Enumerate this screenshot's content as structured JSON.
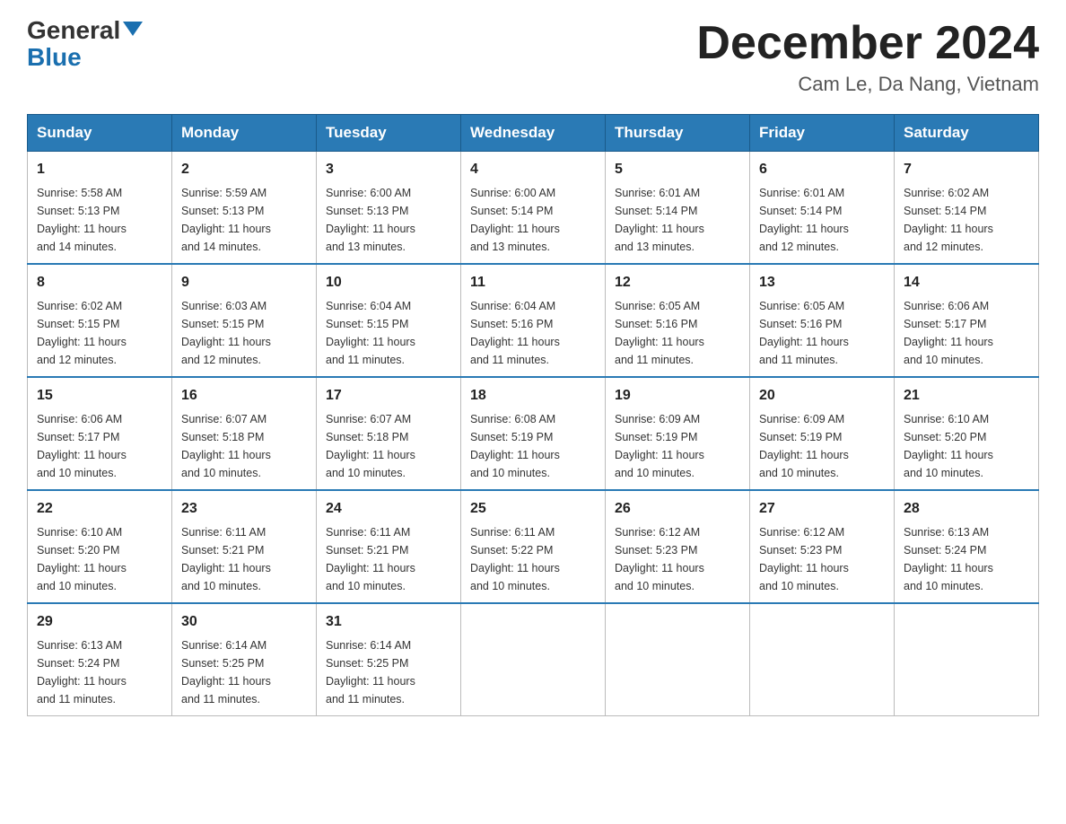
{
  "header": {
    "logo_line1": "General",
    "logo_line2": "Blue",
    "title": "December 2024",
    "subtitle": "Cam Le, Da Nang, Vietnam"
  },
  "days_of_week": [
    "Sunday",
    "Monday",
    "Tuesday",
    "Wednesday",
    "Thursday",
    "Friday",
    "Saturday"
  ],
  "weeks": [
    [
      {
        "day": "1",
        "sunrise": "5:58 AM",
        "sunset": "5:13 PM",
        "daylight": "11 hours and 14 minutes."
      },
      {
        "day": "2",
        "sunrise": "5:59 AM",
        "sunset": "5:13 PM",
        "daylight": "11 hours and 14 minutes."
      },
      {
        "day": "3",
        "sunrise": "6:00 AM",
        "sunset": "5:13 PM",
        "daylight": "11 hours and 13 minutes."
      },
      {
        "day": "4",
        "sunrise": "6:00 AM",
        "sunset": "5:14 PM",
        "daylight": "11 hours and 13 minutes."
      },
      {
        "day": "5",
        "sunrise": "6:01 AM",
        "sunset": "5:14 PM",
        "daylight": "11 hours and 13 minutes."
      },
      {
        "day": "6",
        "sunrise": "6:01 AM",
        "sunset": "5:14 PM",
        "daylight": "11 hours and 12 minutes."
      },
      {
        "day": "7",
        "sunrise": "6:02 AM",
        "sunset": "5:14 PM",
        "daylight": "11 hours and 12 minutes."
      }
    ],
    [
      {
        "day": "8",
        "sunrise": "6:02 AM",
        "sunset": "5:15 PM",
        "daylight": "11 hours and 12 minutes."
      },
      {
        "day": "9",
        "sunrise": "6:03 AM",
        "sunset": "5:15 PM",
        "daylight": "11 hours and 12 minutes."
      },
      {
        "day": "10",
        "sunrise": "6:04 AM",
        "sunset": "5:15 PM",
        "daylight": "11 hours and 11 minutes."
      },
      {
        "day": "11",
        "sunrise": "6:04 AM",
        "sunset": "5:16 PM",
        "daylight": "11 hours and 11 minutes."
      },
      {
        "day": "12",
        "sunrise": "6:05 AM",
        "sunset": "5:16 PM",
        "daylight": "11 hours and 11 minutes."
      },
      {
        "day": "13",
        "sunrise": "6:05 AM",
        "sunset": "5:16 PM",
        "daylight": "11 hours and 11 minutes."
      },
      {
        "day": "14",
        "sunrise": "6:06 AM",
        "sunset": "5:17 PM",
        "daylight": "11 hours and 10 minutes."
      }
    ],
    [
      {
        "day": "15",
        "sunrise": "6:06 AM",
        "sunset": "5:17 PM",
        "daylight": "11 hours and 10 minutes."
      },
      {
        "day": "16",
        "sunrise": "6:07 AM",
        "sunset": "5:18 PM",
        "daylight": "11 hours and 10 minutes."
      },
      {
        "day": "17",
        "sunrise": "6:07 AM",
        "sunset": "5:18 PM",
        "daylight": "11 hours and 10 minutes."
      },
      {
        "day": "18",
        "sunrise": "6:08 AM",
        "sunset": "5:19 PM",
        "daylight": "11 hours and 10 minutes."
      },
      {
        "day": "19",
        "sunrise": "6:09 AM",
        "sunset": "5:19 PM",
        "daylight": "11 hours and 10 minutes."
      },
      {
        "day": "20",
        "sunrise": "6:09 AM",
        "sunset": "5:19 PM",
        "daylight": "11 hours and 10 minutes."
      },
      {
        "day": "21",
        "sunrise": "6:10 AM",
        "sunset": "5:20 PM",
        "daylight": "11 hours and 10 minutes."
      }
    ],
    [
      {
        "day": "22",
        "sunrise": "6:10 AM",
        "sunset": "5:20 PM",
        "daylight": "11 hours and 10 minutes."
      },
      {
        "day": "23",
        "sunrise": "6:11 AM",
        "sunset": "5:21 PM",
        "daylight": "11 hours and 10 minutes."
      },
      {
        "day": "24",
        "sunrise": "6:11 AM",
        "sunset": "5:21 PM",
        "daylight": "11 hours and 10 minutes."
      },
      {
        "day": "25",
        "sunrise": "6:11 AM",
        "sunset": "5:22 PM",
        "daylight": "11 hours and 10 minutes."
      },
      {
        "day": "26",
        "sunrise": "6:12 AM",
        "sunset": "5:23 PM",
        "daylight": "11 hours and 10 minutes."
      },
      {
        "day": "27",
        "sunrise": "6:12 AM",
        "sunset": "5:23 PM",
        "daylight": "11 hours and 10 minutes."
      },
      {
        "day": "28",
        "sunrise": "6:13 AM",
        "sunset": "5:24 PM",
        "daylight": "11 hours and 10 minutes."
      }
    ],
    [
      {
        "day": "29",
        "sunrise": "6:13 AM",
        "sunset": "5:24 PM",
        "daylight": "11 hours and 11 minutes."
      },
      {
        "day": "30",
        "sunrise": "6:14 AM",
        "sunset": "5:25 PM",
        "daylight": "11 hours and 11 minutes."
      },
      {
        "day": "31",
        "sunrise": "6:14 AM",
        "sunset": "5:25 PM",
        "daylight": "11 hours and 11 minutes."
      },
      null,
      null,
      null,
      null
    ]
  ],
  "labels": {
    "sunrise": "Sunrise:",
    "sunset": "Sunset:",
    "daylight": "Daylight:"
  }
}
